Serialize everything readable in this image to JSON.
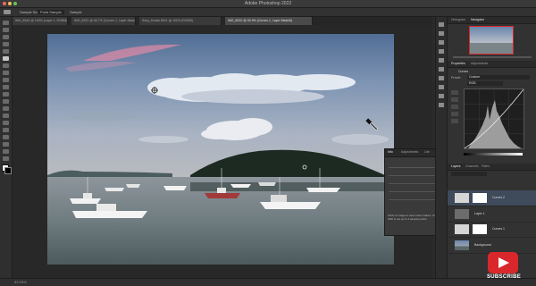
{
  "app": {
    "title": "Adobe Photoshop 2022",
    "status_text": "53.93%"
  },
  "options_bar": {
    "sample_size": "Sample Size",
    "point_sample": "Point Sample",
    "sample": "Sample"
  },
  "tabs": [
    {
      "label": "IMG_8943 @ 100% (Layer 1, RGB/8)",
      "active": false
    },
    {
      "label": "IMG_8921 @ 66.7% (Curves 1, Layer Mask/8)",
      "active": false
    },
    {
      "label": "Sony_Kodak 8921 @ 100% (RGB/8)",
      "active": false
    },
    {
      "label": "IMG_8910 @ 53.9% (Curves 1, Layer Mask/8)",
      "active": true
    }
  ],
  "panels": {
    "top_tabs": [
      "Histogram",
      "Navigator"
    ],
    "properties_tabs": [
      "Properties",
      "Adjustments"
    ],
    "properties_title": "Curves",
    "preset_label": "Preset:",
    "preset_value": "Custom",
    "channel_value": "RGB",
    "layers_tabs": [
      "Layers",
      "Channels",
      "Paths"
    ],
    "layers": [
      {
        "name": "Curves 2",
        "type": "adjust"
      },
      {
        "name": "Layer 1",
        "type": "plain"
      },
      {
        "name": "Curves 1",
        "type": "adjust"
      },
      {
        "name": "Background",
        "type": "image"
      }
    ]
  },
  "info_panel": {
    "tabs": [
      "Info",
      "Adjustments",
      "Libr"
    ],
    "note": "Click on image to view colour values. Use Shift to set up to 4 sample points."
  },
  "badge": {
    "label": "SUBSCRIBE",
    "color": "#d9272b"
  },
  "icons": [
    "eyedropper-icon",
    "move-icon",
    "marquee-icon",
    "lasso-icon",
    "crop-icon",
    "brush-icon",
    "eraser-icon",
    "type-icon",
    "hand-icon",
    "zoom-icon",
    "play-icon"
  ]
}
